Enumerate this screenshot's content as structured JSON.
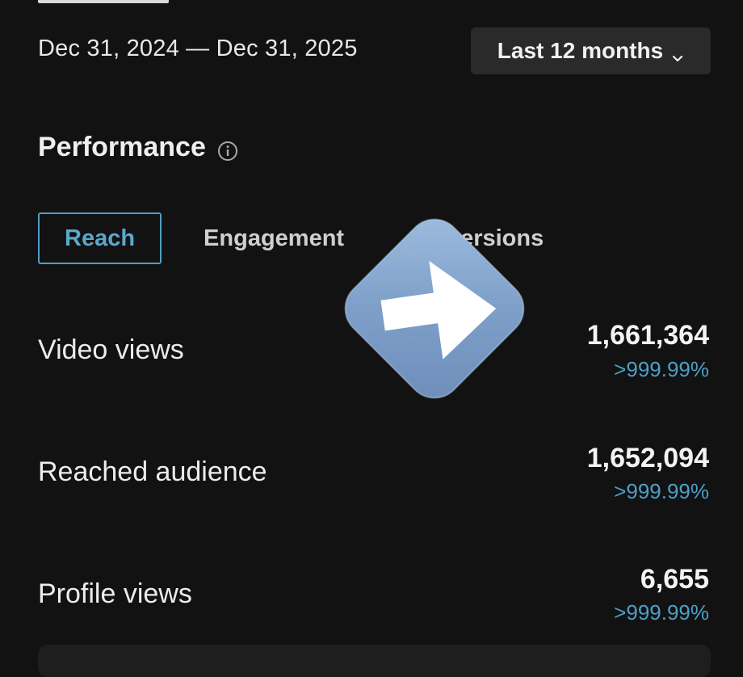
{
  "header": {
    "date_range": "Dec 31, 2024 — Dec 31, 2025",
    "range_selector": "Last 12 months",
    "range_selector_icon": "chevron-down-icon"
  },
  "performance": {
    "title": "Performance",
    "title_icon": "info-icon",
    "tabs": [
      {
        "label": "Reach",
        "active": true
      },
      {
        "label": "Engagement",
        "active": false
      },
      {
        "label": "ersions",
        "active": false
      }
    ],
    "metrics": [
      {
        "label": "Video views",
        "value": "1,661,364",
        "change": ">999.99%"
      },
      {
        "label": "Reached audience",
        "value": "1,652,094",
        "change": ">999.99%"
      },
      {
        "label": "Profile views",
        "value": "6,655",
        "change": ">999.99%"
      }
    ]
  },
  "overlay": {
    "icon": "right-arrow-icon"
  },
  "colors": {
    "background": "#121212",
    "accent": "#4e9ec4",
    "dropdown_bg": "#2a2a2a"
  }
}
